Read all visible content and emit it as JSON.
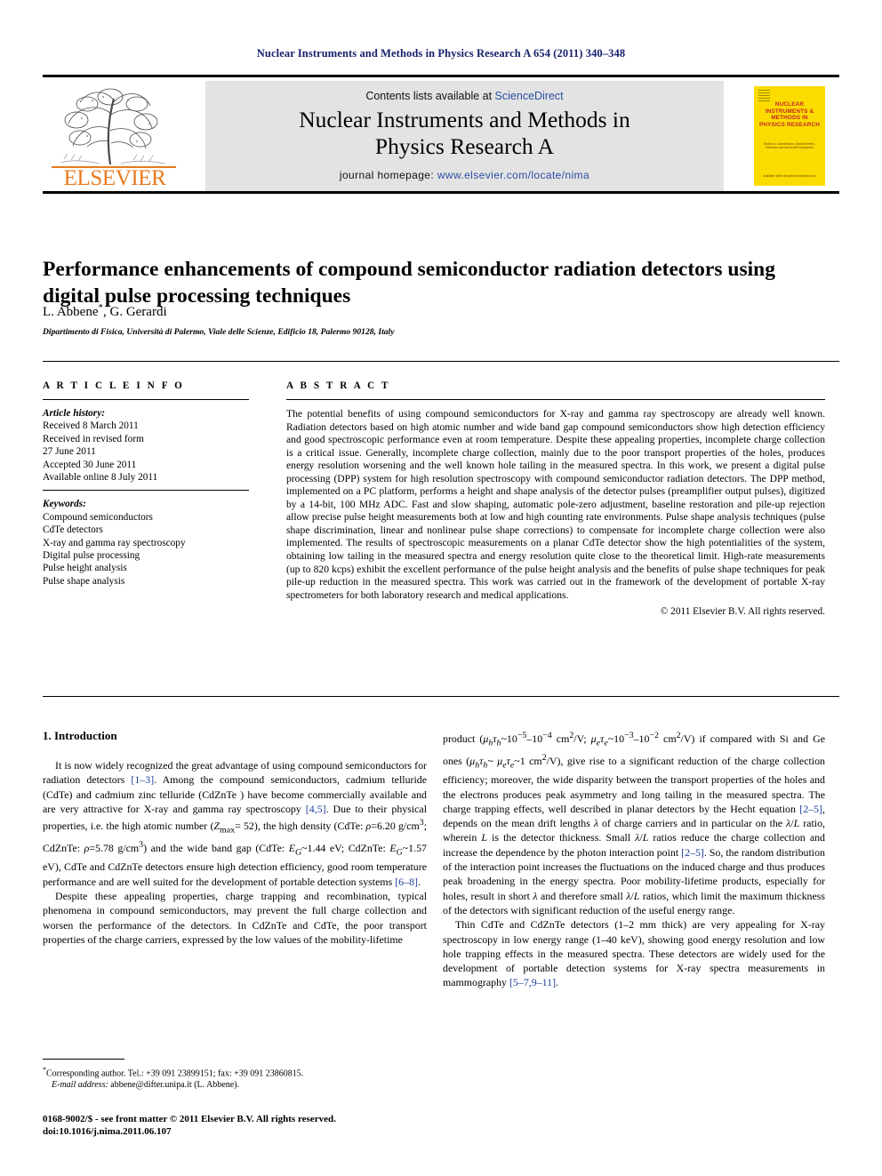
{
  "running_head": "Nuclear Instruments and Methods in Physics Research A 654 (2011) 340–348",
  "masthead": {
    "publisher_name": "ELSEVIER",
    "contents_prefix": "Contents lists available at ",
    "contents_link": "ScienceDirect",
    "journal_title_line1": "Nuclear Instruments and Methods in",
    "journal_title_line2": "Physics Research A",
    "homepage_prefix": "journal homepage: ",
    "homepage_url": "www.elsevier.com/locate/nima",
    "cover": {
      "title": "NUCLEAR INSTRUMENTS & METHODS IN PHYSICS RESEARCH",
      "subtitle": "Section A: Accelerators, Spectrometers, Detectors and Associated Equipment",
      "footer": "Available online at www.sciencedirect.com"
    }
  },
  "article": {
    "title": "Performance enhancements of compound semiconductor radiation detectors using digital pulse processing techniques",
    "authors": "L. Abbene",
    "authors_rest": ", G. Gerardi",
    "corresponding_marker": "*",
    "affiliation": "Dipartimento di Fisica, Università di Palermo, Viale delle Scienze, Edificio 18, Palermo 90128, Italy"
  },
  "article_info": {
    "heading": "A R T I C L E   I N F O",
    "history_label": "Article history:",
    "history": [
      "Received 8 March 2011",
      "Received in revised form",
      "27 June 2011",
      "Accepted 30 June 2011",
      "Available online 8 July 2011"
    ],
    "keywords_label": "Keywords:",
    "keywords": [
      "Compound semiconductors",
      "CdTe detectors",
      "X-ray and gamma ray spectroscopy",
      "Digital pulse processing",
      "Pulse height analysis",
      "Pulse shape analysis"
    ]
  },
  "abstract": {
    "heading": "A B S T R A C T",
    "text": "The potential benefits of using compound semiconductors for X-ray and gamma ray spectroscopy are already well known. Radiation detectors based on high atomic number and wide band gap compound semiconductors show high detection efficiency and good spectroscopic performance even at room temperature. Despite these appealing properties, incomplete charge collection is a critical issue. Generally, incomplete charge collection, mainly due to the poor transport properties of the holes, produces energy resolution worsening and the well known hole tailing in the measured spectra. In this work, we present a digital pulse processing (DPP) system for high resolution spectroscopy with compound semiconductor radiation detectors. The DPP method, implemented on a PC platform, performs a height and shape analysis of the detector pulses (preamplifier output pulses), digitized by a 14-bit, 100 MHz ADC. Fast and slow shaping, automatic pole-zero adjustment, baseline restoration and pile-up rejection allow precise pulse height measurements both at low and high counting rate environments. Pulse shape analysis techniques (pulse shape discrimination, linear and nonlinear pulse shape corrections) to compensate for incomplete charge collection were also implemented. The results of spectroscopic measurements on a planar CdTe detector show the high potentialities of the system, obtaining low tailing in the measured spectra and energy resolution quite close to the theoretical limit. High-rate measurements (up to 820 kcps) exhibit the excellent performance of the pulse height analysis and the benefits of pulse shape techniques for peak pile-up reduction in the measured spectra. This work was carried out in the framework of the development of portable X-ray spectrometers for both laboratory research and medical applications.",
    "copyright": "© 2011 Elsevier B.V. All rights reserved."
  },
  "body": {
    "section_number_title": "1.  Introduction",
    "left_paragraphs": [
      "It is now widely recognized the great advantage of using compound semiconductors for radiation detectors [1–3]. Among the compound semiconductors, cadmium telluride (CdTe) and cadmium zinc telluride (CdZnTe ) have become commercially available and are very attractive for X-ray and gamma ray spectroscopy [4,5]. Due to their physical properties, i.e. the high atomic number (Zmax= 52), the high density (CdTe: ρ=6.20 g/cm3; CdZnTe: ρ=5.78 g/cm3) and the wide band gap (CdTe: EG~1.44 eV; CdZnTe: EG~1.57 eV), CdTe and CdZnTe detectors ensure high detection efficiency, good room temperature performance and are well suited for the development of portable detection systems [6–8].",
      "Despite these appealing properties, charge trapping and recombination, typical phenomena in compound semiconductors, may prevent the full charge collection and worsen the performance of the detectors. In CdZnTe and CdTe, the poor transport properties of the charge carriers, expressed by the low values of the mobility-lifetime"
    ],
    "right_paragraphs": [
      "product (μhτh~10−5–10−4 cm2/V; μeτe~10−3–10−2 cm2/V) if compared with Si and Ge ones (μhτh~ μeτe~1 cm2/V), give rise to a significant reduction of the charge collection efficiency; moreover, the wide disparity between the transport properties of the holes and the electrons produces peak asymmetry and long tailing in the measured spectra. The charge trapping effects, well described in planar detectors by the Hecht equation [2–5], depends on the mean drift lengths λ of charge carriers and in particular on the λ/L ratio, wherein L is the detector thickness. Small λ/L ratios reduce the charge collection and increase the dependence by the photon interaction point [2–5]. So, the random distribution of the interaction point increases the fluctuations on the induced charge and thus produces peak broadening in the energy spectra. Poor mobility-lifetime products, especially for holes, result in short λ and therefore small λ/L ratios, which limit the maximum thickness of the detectors with significant reduction of the useful energy range.",
      "Thin CdTe and CdZnTe detectors (1–2 mm thick) are very appealing for X-ray spectroscopy in low energy range (1–40 keV), showing good energy resolution and low hole trapping effects in the measured spectra. These detectors are widely used for the development of portable detection systems for X-ray spectra measurements in mammography [5–7,9–11]."
    ]
  },
  "footnotes": {
    "corresponding": "Corresponding author. Tel.: +39 091 23899151; fax: +39 091 23860815.",
    "email_label": "E-mail address:",
    "email": "abbene@difter.unipa.it (L. Abbene)."
  },
  "imprint": {
    "issn_line": "0168-9002/$ - see front matter © 2011 Elsevier B.V. All rights reserved.",
    "doi_line": "doi:10.1016/j.nima.2011.06.107"
  },
  "colors": {
    "running_head": "#16216b",
    "link": "#2a4ea3",
    "reference": "#1f3f9e",
    "elsevier_orange": "#e87a1e",
    "cover_yellow": "#fcdc00",
    "cover_red": "#c0252a",
    "masthead_gray": "#e3e3e3"
  }
}
